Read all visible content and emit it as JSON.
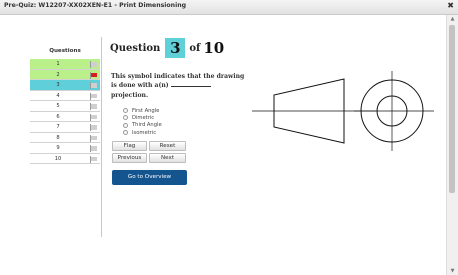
{
  "window": {
    "title": "Pre-Quiz: W12207-XX02XEN-E1 - Print Dimensioning",
    "close_glyph": "✖"
  },
  "question_list": {
    "header": "Questions",
    "items": [
      {
        "number": "1",
        "status": "answered",
        "flagged": false
      },
      {
        "number": "2",
        "status": "answered",
        "flagged": true
      },
      {
        "number": "3",
        "status": "current",
        "flagged": false
      },
      {
        "number": "4",
        "status": "unanswered",
        "flagged": false
      },
      {
        "number": "5",
        "status": "unanswered",
        "flagged": false
      },
      {
        "number": "6",
        "status": "unanswered",
        "flagged": false
      },
      {
        "number": "7",
        "status": "unanswered",
        "flagged": false
      },
      {
        "number": "8",
        "status": "unanswered",
        "flagged": false
      },
      {
        "number": "9",
        "status": "unanswered",
        "flagged": false
      },
      {
        "number": "10",
        "status": "unanswered",
        "flagged": false
      }
    ]
  },
  "question": {
    "word": "Question",
    "current": "3",
    "of": "of",
    "total": "10",
    "text_before": "This symbol indicates that the drawing is done with a(n)",
    "text_after": "projection."
  },
  "options": [
    "First Angle",
    "Dimetric",
    "Third Angle",
    "Isometric"
  ],
  "buttons": {
    "flag": "Flag",
    "reset": "Reset",
    "previous": "Previous",
    "next": "Next",
    "overview": "Go to Overview"
  },
  "scrollbar": {
    "up_glyph": "▲",
    "down_glyph": "▼"
  },
  "colors": {
    "answered": "#b9f08a",
    "current": "#5fcfd9",
    "flag_on": "#d42020",
    "primary": "#15558f"
  },
  "icons": {
    "flag": "flag-icon",
    "close": "close-icon",
    "projection_symbol": "projection-symbol-icon"
  }
}
